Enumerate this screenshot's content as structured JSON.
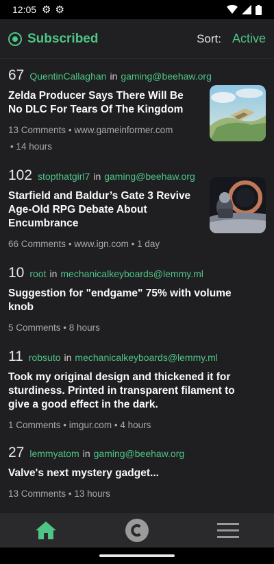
{
  "status": {
    "time": "12:05",
    "left_icons": [
      "gear-icon",
      "gear-icon"
    ],
    "right_icons": [
      "wifi-icon",
      "signal-icon",
      "battery-icon"
    ]
  },
  "header": {
    "icon": "subscribed-icon",
    "title": "Subscribed",
    "sort_label": "Sort:",
    "sort_value": "Active",
    "accent": "#4ec486"
  },
  "posts": [
    {
      "score": "67",
      "author": "QuentinCallaghan",
      "in": "in",
      "community": "gaming@beehaw.org",
      "title": "Zelda Producer Says There Will Be No DLC For Tears Of The Kingdom",
      "comments": "13 Comments",
      "domain": "www.gameinformer.com",
      "time": "14 hours",
      "has_thumbnail": true
    },
    {
      "score": "102",
      "author": "stopthatgirl7",
      "in": "in",
      "community": "gaming@beehaw.org",
      "title": "Starfield and Baldur’s Gate 3 Revive Age-Old RPG Debate About Encumbrance",
      "comments": "66 Comments",
      "domain": "www.ign.com",
      "time": "1 day",
      "has_thumbnail": true
    },
    {
      "score": "10",
      "author": "root",
      "in": "in",
      "community": "mechanicalkeyboards@lemmy.ml",
      "title": "Suggestion for \"endgame\" 75% with volume knob",
      "comments": "5 Comments",
      "time": "8 hours",
      "has_thumbnail": false
    },
    {
      "score": "11",
      "author": "robsuto",
      "in": "in",
      "community": "mechanicalkeyboards@lemmy.ml",
      "title": "Took my original design and thickened it for sturdiness. Printed in transparent filament to give a good effect in the dark.",
      "comments": "1 Comments",
      "domain": "imgur.com",
      "time": "4 hours",
      "has_thumbnail": false
    },
    {
      "score": "27",
      "author": "lemmyatom",
      "in": "in",
      "community": "gaming@beehaw.org",
      "title": "Valve's next mystery gadget...",
      "comments": "13 Comments",
      "time": "13 hours",
      "has_thumbnail": false
    }
  ],
  "separators": {
    "bullet": "•",
    "dot": "• "
  },
  "bottom_nav": [
    {
      "icon": "home-icon",
      "active": true
    },
    {
      "icon": "communities-icon",
      "active": false
    },
    {
      "icon": "menu-icon",
      "active": false
    }
  ]
}
